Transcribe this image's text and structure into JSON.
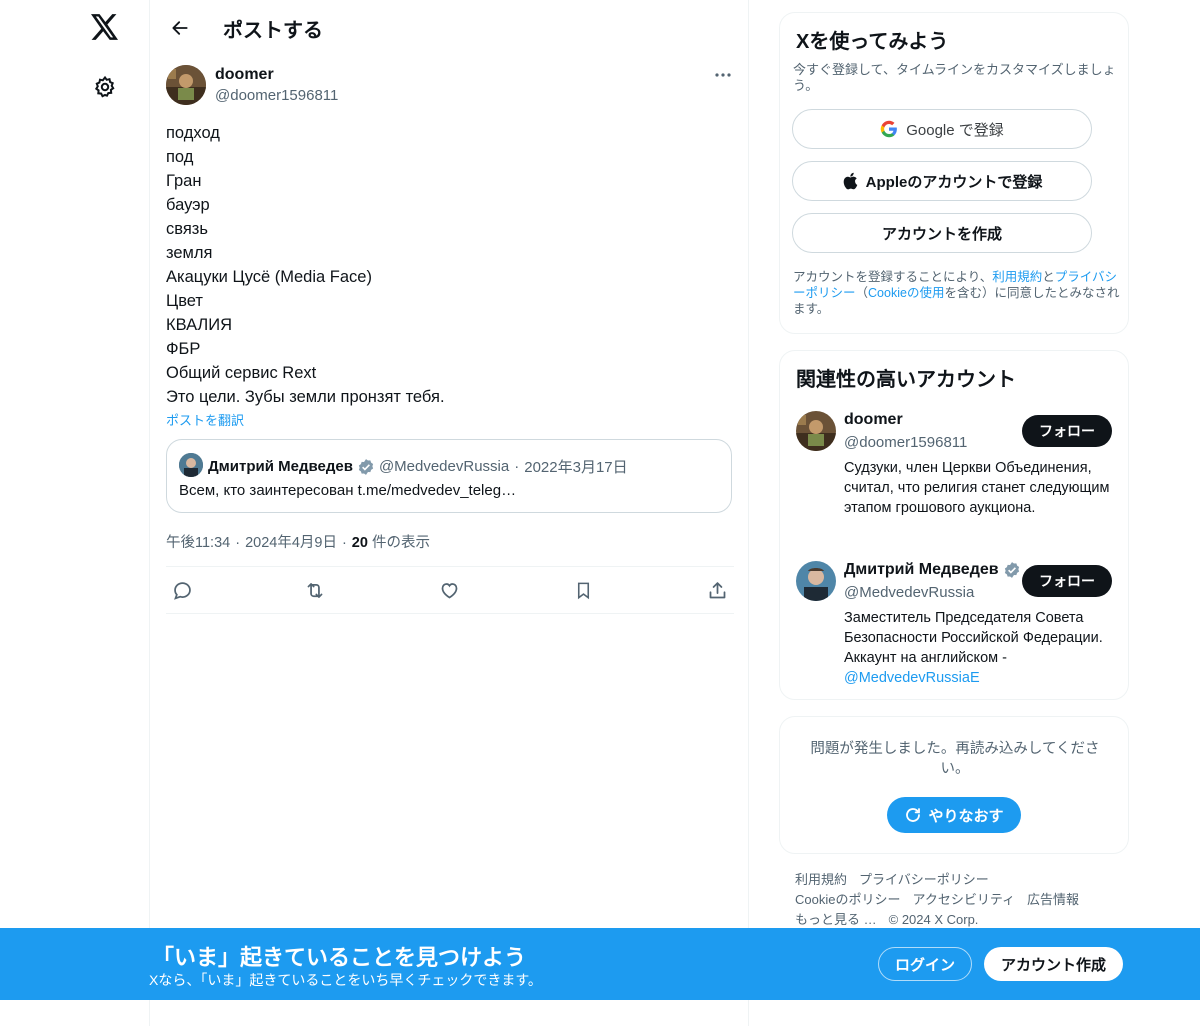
{
  "nav": {
    "logo_icon": "x-logo-icon",
    "settings_icon": "gear-icon"
  },
  "header": {
    "title": "ポストする"
  },
  "post": {
    "author_name": "doomer",
    "author_handle": "@doomer1596811",
    "lines": [
      "подход",
      "под",
      "Гран",
      "бауэр",
      "связь",
      "земля",
      "Акацуки Цусё (Media Face)",
      "Цвет",
      "КВАЛИЯ",
      "ФБР",
      "Общий сервис Rext",
      "Это цели. Зубы земли пронзят тебя."
    ],
    "translate_label": "ポストを翻訳",
    "quote": {
      "name": "Дмитрий Медведев",
      "handle": "@MedvedevRussia",
      "separator": "·",
      "date": "2022年3月17日",
      "text": "Всем, кто заинтересован t.me/medvedev_teleg…"
    },
    "meta": {
      "time": "午後11:34",
      "date": "2024年4月9日",
      "dot": "·",
      "views_count": "20",
      "views_label": "件の表示"
    }
  },
  "signup": {
    "title": "Xを使ってみよう",
    "subtitle": "今すぐ登録して、タイムラインをカスタマイズしましょう。",
    "google_label": "Google で登録",
    "apple_label": "Appleのアカウントで登録",
    "create_label": "アカウントを作成",
    "legal_prefix": "アカウントを登録することにより、",
    "legal_terms": "利用規約",
    "legal_and": "と",
    "legal_privacy": "プライバシーポリシー",
    "legal_paren_open": "（",
    "legal_cookie": "Cookieの使用",
    "legal_suffix": "を含む）に同意したとみなされます。"
  },
  "related": {
    "title": "関連性の高いアカウント",
    "accounts": [
      {
        "name": "doomer",
        "handle": "@doomer1596811",
        "bio": "Судзуки, член Церкви Объединения, считал, что религия станет следующим этапом грошового аукциона.",
        "follow_label": "フォロー"
      },
      {
        "name": "Дмитрий Медведев",
        "handle": "@MedvedevRussia",
        "bio": "Заместитель Председателя Совета Безопасности Российской Федерации. Аккаунт на английском - ",
        "bio_link": "@MedvedevRussiaE",
        "follow_label": "フォロー"
      }
    ]
  },
  "error": {
    "text": "問題が発生しました。再読み込みしてください。",
    "retry_label": "やりなおす"
  },
  "footer": {
    "terms": "利用規約",
    "privacy": "プライバシーポリシー",
    "cookie": "Cookieのポリシー",
    "accessibility": "アクセシビリティ",
    "ads": "広告情報",
    "more": "もっと見る …",
    "copyright": "© 2024 X Corp."
  },
  "banner": {
    "title": "「いま」起きていることを見つけよう",
    "subtitle": "Xなら、「いま」起きていることをいち早くチェックできます。",
    "login_label": "ログイン",
    "create_label": "アカウント作成"
  },
  "colors": {
    "accent": "#1d9bf0",
    "text": "#0f1419",
    "muted": "#536471",
    "border": "#eff3f4"
  }
}
